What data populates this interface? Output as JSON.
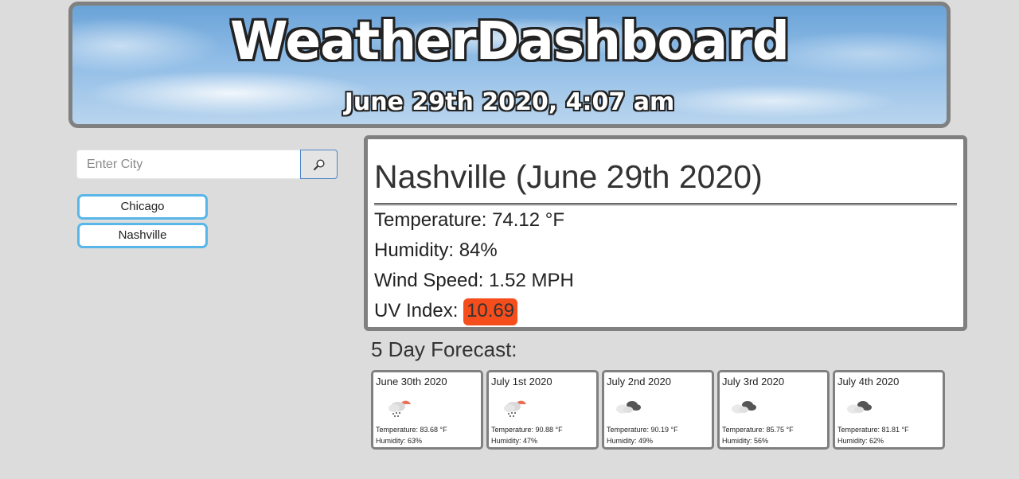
{
  "header": {
    "title": "WeatherDashboard",
    "datetime": "June 29th 2020, 4:07 am"
  },
  "search": {
    "placeholder": "Enter City",
    "value": "",
    "button_icon": "search-icon"
  },
  "history": [
    {
      "label": "Chicago"
    },
    {
      "label": "Nashville"
    }
  ],
  "current": {
    "title": "Nashville (June 29th 2020)",
    "temperature": "Temperature: 74.12 °F",
    "humidity": "Humidity: 84%",
    "wind": "Wind Speed: 1.52 MPH",
    "uv_label": "UV Index: ",
    "uv_value": "10.69",
    "uv_color": "#f54d1c"
  },
  "forecast": {
    "heading": "5 Day Forecast:",
    "days": [
      {
        "date": "June 30th 2020",
        "icon": "rain-sun-icon",
        "temp": "Temperature: 83.68 °F",
        "humidity": "Humidity: 63%"
      },
      {
        "date": "July 1st 2020",
        "icon": "rain-sun-icon",
        "temp": "Temperature: 90.88 °F",
        "humidity": "Humidity: 47%"
      },
      {
        "date": "July 2nd 2020",
        "icon": "broken-clouds-icon",
        "temp": "Temperature: 90.19 °F",
        "humidity": "Humidity: 49%"
      },
      {
        "date": "July 3rd 2020",
        "icon": "broken-clouds-icon",
        "temp": "Temperature: 85.75 °F",
        "humidity": "Humidity: 56%"
      },
      {
        "date": "July 4th 2020",
        "icon": "broken-clouds-icon",
        "temp": "Temperature: 81.81 °F",
        "humidity": "Humidity: 62%"
      }
    ]
  },
  "colors": {
    "page_bg": "#dcdcdc",
    "border": "#808080",
    "city_button_border": "#58b6e8"
  }
}
